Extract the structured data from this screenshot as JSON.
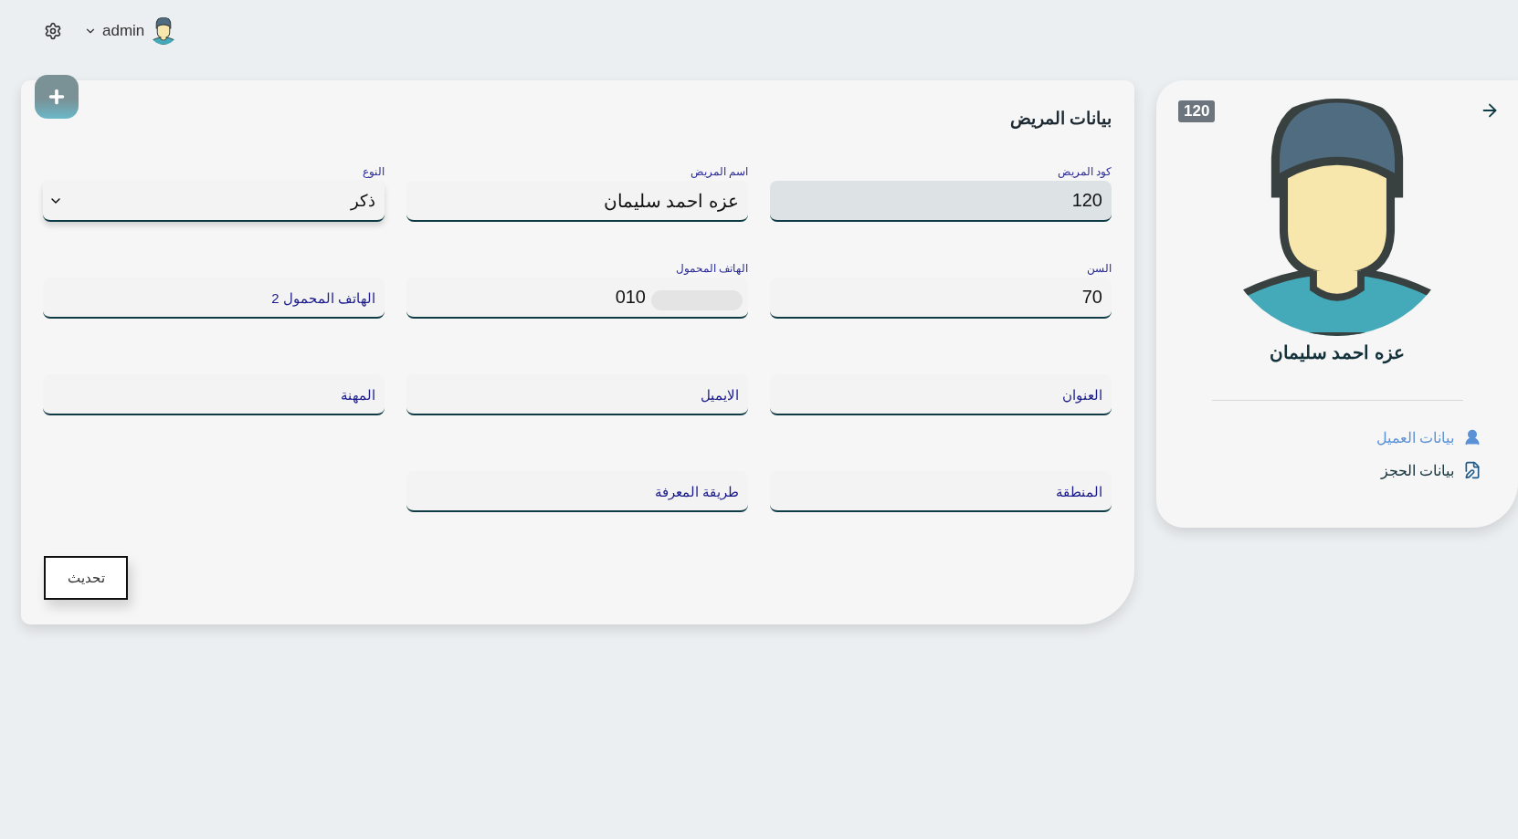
{
  "header": {
    "user": "admin"
  },
  "form": {
    "title": "بيانات المريض",
    "fields": [
      {
        "kind": "input",
        "label": "كود المريض",
        "value": "120",
        "disabled": true
      },
      {
        "kind": "input",
        "label": "اسم المريض",
        "value": "عزه احمد سليمان",
        "disabled": false
      },
      {
        "kind": "select",
        "label": "النوع",
        "value": "ذكر",
        "disabled": false
      },
      {
        "kind": "input",
        "label": "السن",
        "value": "70",
        "disabled": false
      },
      {
        "kind": "input",
        "label": "الهاتف المحمول",
        "value": "010",
        "disabled": false,
        "redacted": true
      },
      {
        "kind": "input",
        "placeholder": "الهاتف المحمول 2",
        "disabled": false
      },
      {
        "kind": "input",
        "placeholder": "العنوان",
        "disabled": false
      },
      {
        "kind": "input",
        "placeholder": "الايميل",
        "disabled": false
      },
      {
        "kind": "input",
        "placeholder": "المهنة",
        "disabled": false
      },
      {
        "kind": "input",
        "placeholder": "المنطقة",
        "disabled": false
      },
      {
        "kind": "input",
        "placeholder": "طريقة المعرفة",
        "disabled": false
      }
    ],
    "submit": "تحديث"
  },
  "profile": {
    "badge": "120",
    "name": "عزه احمد سليمان",
    "links": [
      {
        "label": "بيانات العميل",
        "selected": true
      },
      {
        "label": "بيانات الحجز",
        "selected": false
      }
    ]
  }
}
